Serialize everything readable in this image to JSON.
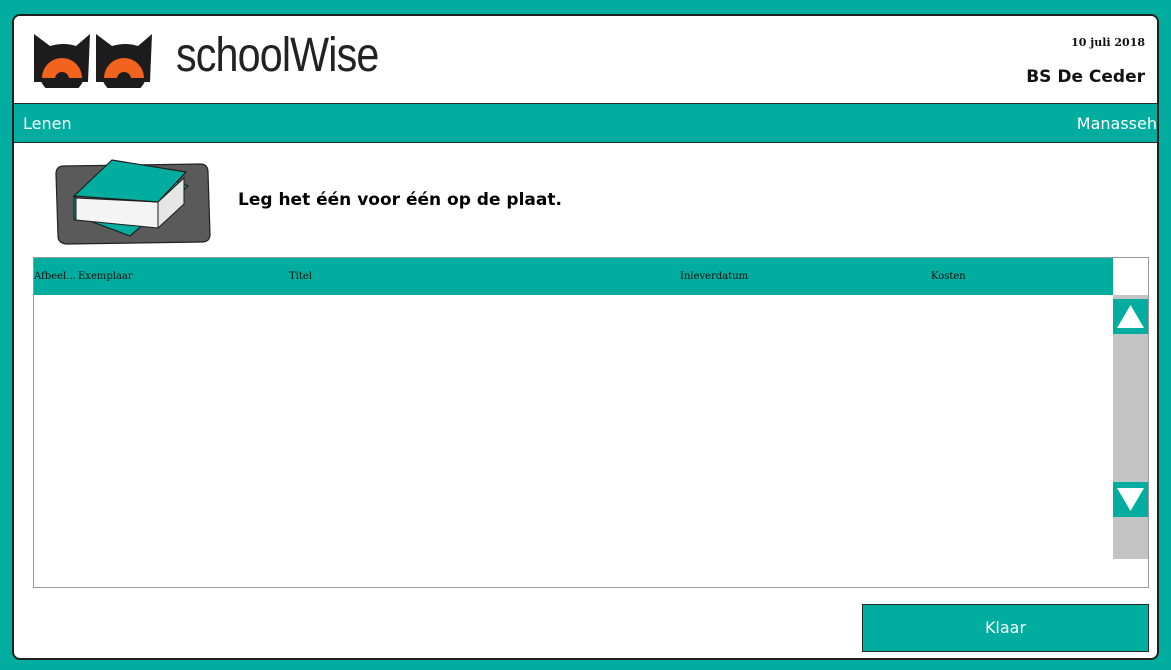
{
  "app": {
    "name": "schoolWise",
    "date": "10 juli 2018",
    "school": "BS De Ceder"
  },
  "nav": {
    "left_label": "Lenen",
    "right_label": "Manasseh"
  },
  "instruction": {
    "text": "Leg het één voor één op de plaat.",
    "icon": "book-on-plate-icon"
  },
  "table": {
    "columns": [
      "Afbeel...",
      "Exemplaar",
      "Titel",
      "Inleverdatum",
      "Kosten"
    ],
    "rows": []
  },
  "actions": {
    "done_label": "Klaar"
  },
  "colors": {
    "accent": "#00ad9f",
    "owl_orange": "#f2631e",
    "owl_dark": "#1c1c1c",
    "plate": "#5a5a5a",
    "scroll_track": "#c4c4c4"
  }
}
